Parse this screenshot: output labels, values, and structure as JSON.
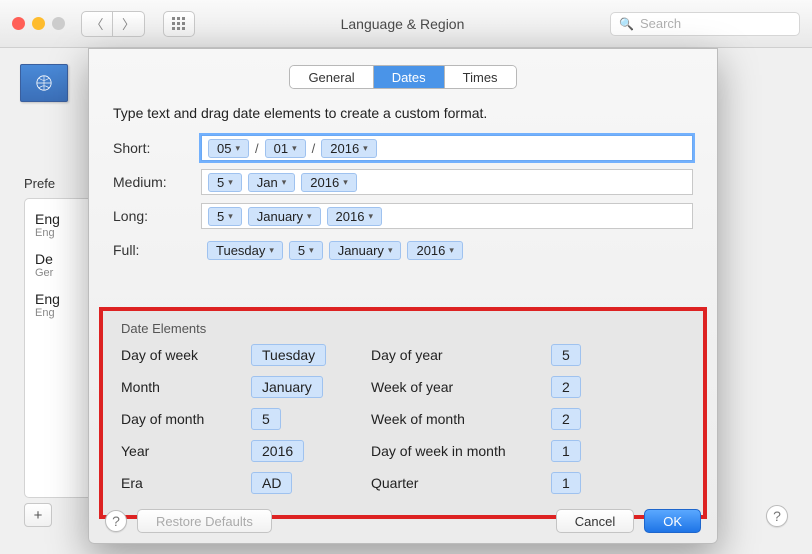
{
  "window": {
    "title": "Language & Region",
    "search_placeholder": "Search"
  },
  "sidebar": {
    "preferred_label": "Prefe",
    "languages": [
      {
        "main": "Eng",
        "sub": "Eng"
      },
      {
        "main": "De",
        "sub": "Ger"
      },
      {
        "main": "Eng",
        "sub": "Eng"
      }
    ],
    "add_label": "+"
  },
  "sheet": {
    "tabs": [
      "General",
      "Dates",
      "Times"
    ],
    "selected_tab": "Dates",
    "instruction": "Type text and drag date elements to create a custom format.",
    "formats": {
      "short": {
        "label": "Short:",
        "parts": [
          "05",
          "/",
          "01",
          "/",
          "2016"
        ]
      },
      "medium": {
        "label": "Medium:",
        "parts": [
          "5",
          "Jan",
          "2016"
        ]
      },
      "long": {
        "label": "Long:",
        "parts": [
          "5",
          "January",
          "2016"
        ]
      },
      "full": {
        "label": "Full:",
        "parts": [
          "Tuesday",
          "5",
          "January",
          "2016"
        ]
      }
    },
    "elements_title": "Date Elements",
    "elements": [
      {
        "label": "Day of week",
        "value": "Tuesday"
      },
      {
        "label": "Day of year",
        "value": "5"
      },
      {
        "label": "Month",
        "value": "January"
      },
      {
        "label": "Week of year",
        "value": "2"
      },
      {
        "label": "Day of month",
        "value": "5"
      },
      {
        "label": "Week of month",
        "value": "2"
      },
      {
        "label": "Year",
        "value": "2016"
      },
      {
        "label": "Day of week in month",
        "value": "1"
      },
      {
        "label": "Era",
        "value": "AD"
      },
      {
        "label": "Quarter",
        "value": "1"
      }
    ],
    "buttons": {
      "restore": "Restore Defaults",
      "cancel": "Cancel",
      "ok": "OK"
    }
  }
}
